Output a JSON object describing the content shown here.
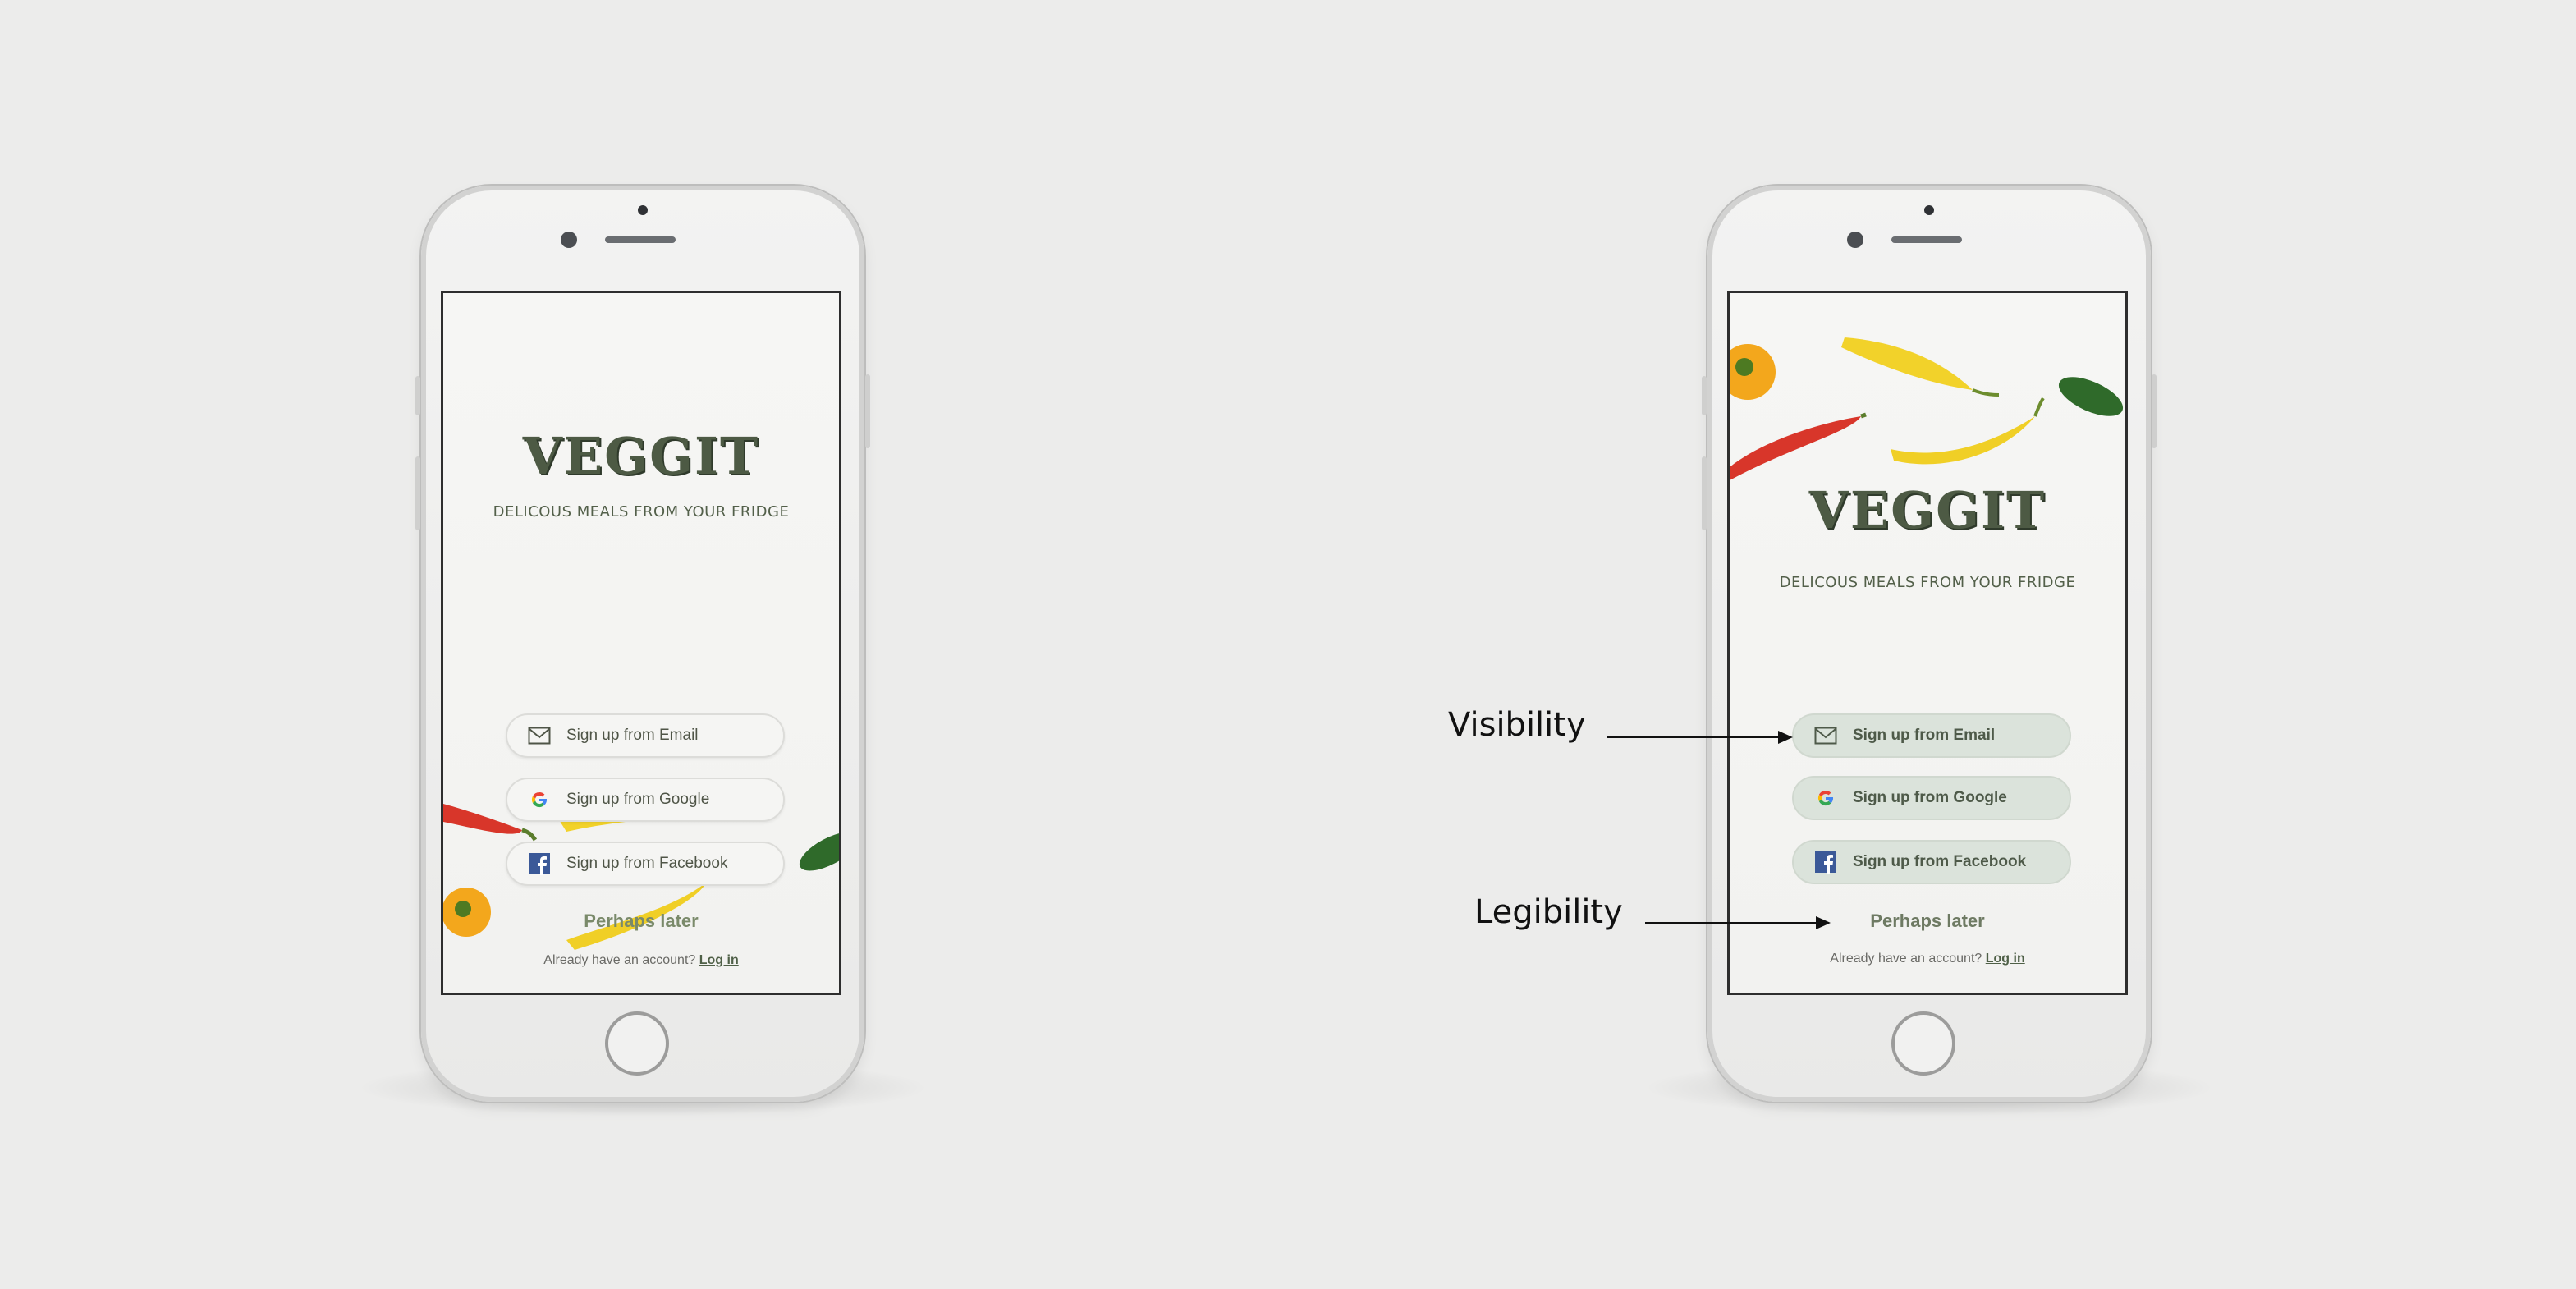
{
  "phones": [
    {
      "variant": "before",
      "app": {
        "logo_text": "VEGGIT",
        "tagline": "DELICOUS MEALS FROM YOUR FRIDGE",
        "buttons": [
          {
            "label": "Sign up from Email",
            "icon": "envelope-icon"
          },
          {
            "label": "Sign up from Google",
            "icon": "google-icon"
          },
          {
            "label": "Sign up from Facebook",
            "icon": "facebook-icon"
          }
        ],
        "skip_label": "Perhaps later",
        "login_prompt": "Already have an account?",
        "login_link": "Log in"
      }
    },
    {
      "variant": "after",
      "app": {
        "logo_text": "VEGGIT",
        "tagline": "DELICOUS MEALS FROM YOUR FRIDGE",
        "buttons": [
          {
            "label": "Sign up from Email",
            "icon": "envelope-icon"
          },
          {
            "label": "Sign up from Google",
            "icon": "google-icon"
          },
          {
            "label": "Sign up from Facebook",
            "icon": "facebook-icon"
          }
        ],
        "skip_label": "Perhaps later",
        "login_prompt": "Already have an account?",
        "login_link": "Log in"
      }
    }
  ],
  "annotations": {
    "visibility": "Visibility",
    "legibility": "Legibility"
  },
  "colors": {
    "background": "#ececeb",
    "brand_green": "#4d5a44",
    "button_tint": "#dbe3db"
  }
}
